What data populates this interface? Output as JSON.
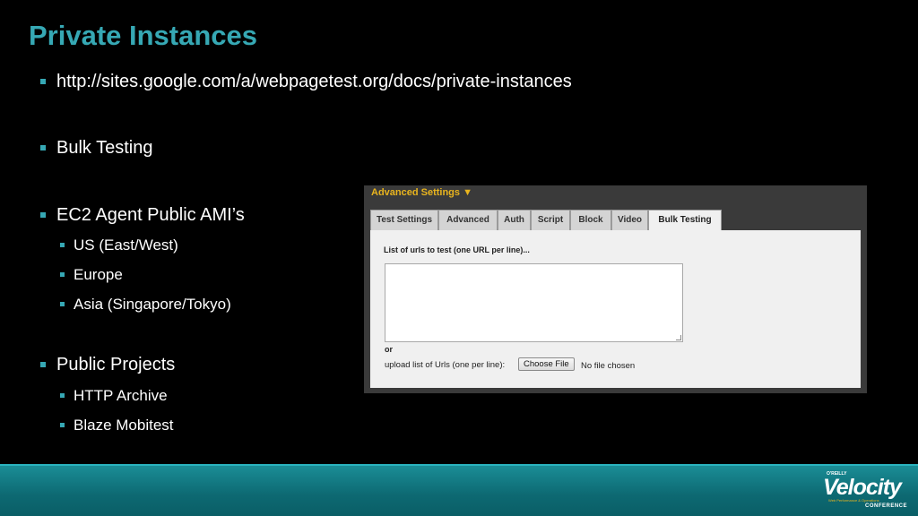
{
  "slide": {
    "title": "Private Instances",
    "bullets": [
      {
        "text": "http://sites.google.com/a/webpagetest.org/docs/private-instances"
      },
      {
        "text": "Bulk Testing"
      },
      {
        "text": "EC2 Agent Public AMI’s",
        "children": [
          "US (East/West)",
          "Europe",
          "Asia (Singapore/Tokyo)"
        ]
      },
      {
        "text": "Public Projects",
        "children": [
          "HTTP Archive",
          "Blaze Mobitest"
        ]
      }
    ]
  },
  "webui": {
    "advanced_settings": "Advanced Settings ▼",
    "tabs": [
      "Test Settings",
      "Advanced",
      "Auth",
      "Script",
      "Block",
      "Video",
      "Bulk Testing"
    ],
    "active_tab": "Bulk Testing",
    "list_label": "List of urls to test (one URL per line)...",
    "urls_value": "",
    "or_label": "or",
    "upload_label": "upload list of Urls (one per line):",
    "choose_file": "Choose File",
    "no_file": "No file chosen"
  },
  "footer": {
    "logo_oreilly": "O'REILLY",
    "logo_word": "Velocity",
    "logo_tagline": "Web Performance & Operations",
    "logo_conference": "CONFERENCE"
  },
  "colors": {
    "title": "#36a8b4",
    "bullet": "#36a8b4",
    "accent_yellow": "#e8b41e",
    "footer": "#0d6972"
  }
}
